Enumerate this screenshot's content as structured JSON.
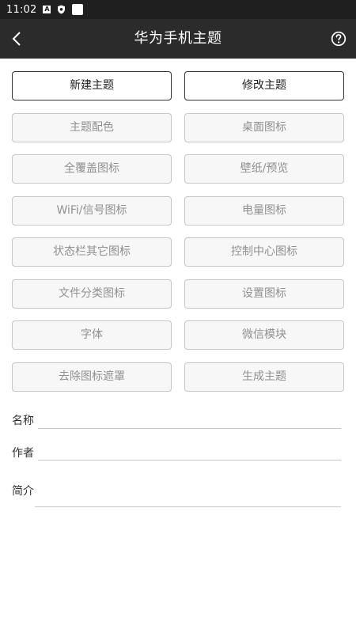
{
  "status_bar": {
    "time": "11:02",
    "icons": [
      "notification-a-icon",
      "shield-icon",
      "square-icon"
    ]
  },
  "app_bar": {
    "title": "华为手机主题",
    "back_icon": "chevron-left-icon",
    "help_icon": "help-circle-icon"
  },
  "buttons": {
    "new_theme": "新建主题",
    "edit_theme": "修改主题",
    "theme_colors": "主题配色",
    "desktop_icons": "桌面图标",
    "full_cover_icons": "全覆盖图标",
    "wallpaper_preview": "壁纸/预览",
    "wifi_signal_icons": "WiFi/信号图标",
    "battery_icons": "电量图标",
    "statusbar_other_icons": "状态栏其它图标",
    "control_center_icons": "控制中心图标",
    "file_category_icons": "文件分类图标",
    "settings_icons": "设置图标",
    "font": "字体",
    "wechat_module": "微信模块",
    "remove_icon_mask": "去除图标遮罩",
    "generate_theme": "生成主题"
  },
  "form": {
    "name_label": "名称",
    "name_value": "",
    "author_label": "作者",
    "author_value": "",
    "intro_label": "简介",
    "intro_value": ""
  },
  "colors": {
    "status_bar_bg": "#1f1f1f",
    "app_bar_bg": "#2b2b2b",
    "primary_border": "#333333",
    "disabled_text": "#909090",
    "disabled_bg": "#f7f7f7"
  }
}
